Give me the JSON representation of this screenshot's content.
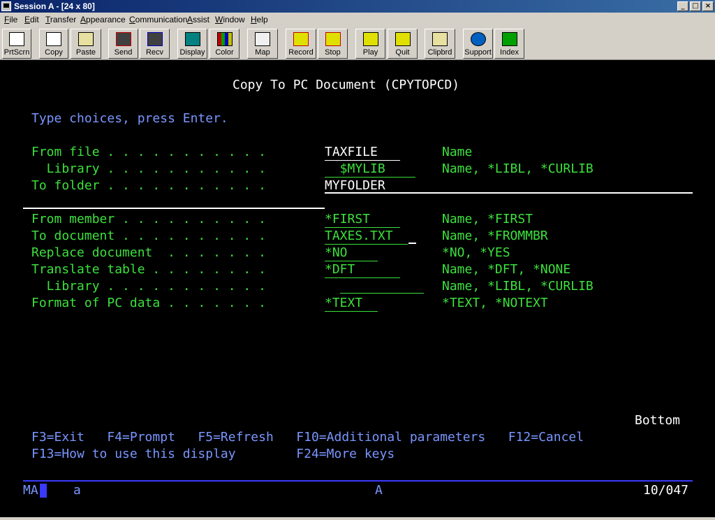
{
  "window": {
    "title": "Session A - [24 x 80]",
    "controls": [
      "_",
      "□",
      "×"
    ]
  },
  "menu": [
    "File",
    "Edit",
    "Transfer",
    "Appearance",
    "Communication",
    "Assist",
    "Window",
    "Help"
  ],
  "toolbar": [
    {
      "label": "PrtScrn",
      "icon": "printer-icon"
    },
    {
      "label": "Copy",
      "icon": "copy-icon"
    },
    {
      "label": "Paste",
      "icon": "paste-icon"
    },
    {
      "label": "Send",
      "icon": "send-icon"
    },
    {
      "label": "Recv",
      "icon": "receive-icon"
    },
    {
      "label": "Display",
      "icon": "display-icon"
    },
    {
      "label": "Color",
      "icon": "color-icon"
    },
    {
      "label": "Map",
      "icon": "map-icon"
    },
    {
      "label": "Record",
      "icon": "record-icon"
    },
    {
      "label": "Stop",
      "icon": "stop-icon"
    },
    {
      "label": "Play",
      "icon": "play-icon"
    },
    {
      "label": "Quit",
      "icon": "quit-icon"
    },
    {
      "label": "Clipbrd",
      "icon": "clipboard-icon"
    },
    {
      "label": "Support",
      "icon": "support-icon"
    },
    {
      "label": "Index",
      "icon": "index-icon"
    }
  ],
  "screen": {
    "heading": "Copy To PC Document (CPYTOPCD)",
    "instruction": "Type choices, press Enter.",
    "rows": [
      {
        "label": "From file . . . . . . . . . . . ",
        "value": "TAXFILE   ",
        "choices": "Name"
      },
      {
        "label": "  Library . . . . . . . . . . . ",
        "value": "  $MYLIB    ",
        "choices": "Name, *LIBL, *CURLIB"
      },
      {
        "label": "To folder . . . . . . . . . . . ",
        "value": "MYFOLDER",
        "choices": ""
      },
      {
        "label": "From member . . . . . . . . . . ",
        "value": "*FIRST    ",
        "choices": "Name, *FIRST"
      },
      {
        "label": "To document . . . . . . . . . . ",
        "value": "TAXES.TXT  ",
        "choices": "Name, *FROMMBR"
      },
      {
        "label": "Replace document  . . . . . . . ",
        "value": "*NO    ",
        "choices": "*NO, *YES"
      },
      {
        "label": "Translate table . . . . . . . . ",
        "value": "*DFT      ",
        "choices": "Name, *DFT, *NONE"
      },
      {
        "label": "  Library . . . . . . . . . . . ",
        "value": "  ",
        "choices": "Name, *LIBL, *CURLIB"
      },
      {
        "label": "Format of PC data . . . . . . . ",
        "value": "*TEXT  ",
        "choices": "*TEXT, *NOTEXT"
      }
    ],
    "more": "Bottom",
    "fkeys_line1": "F3=Exit   F4=Prompt   F5=Refresh   F10=Additional parameters   F12=Cancel",
    "fkeys_line2": "F13=How to use this display        F24=More keys"
  },
  "status": {
    "left": "MA",
    "mode": "a",
    "indicator": "A",
    "position": "10/047"
  }
}
